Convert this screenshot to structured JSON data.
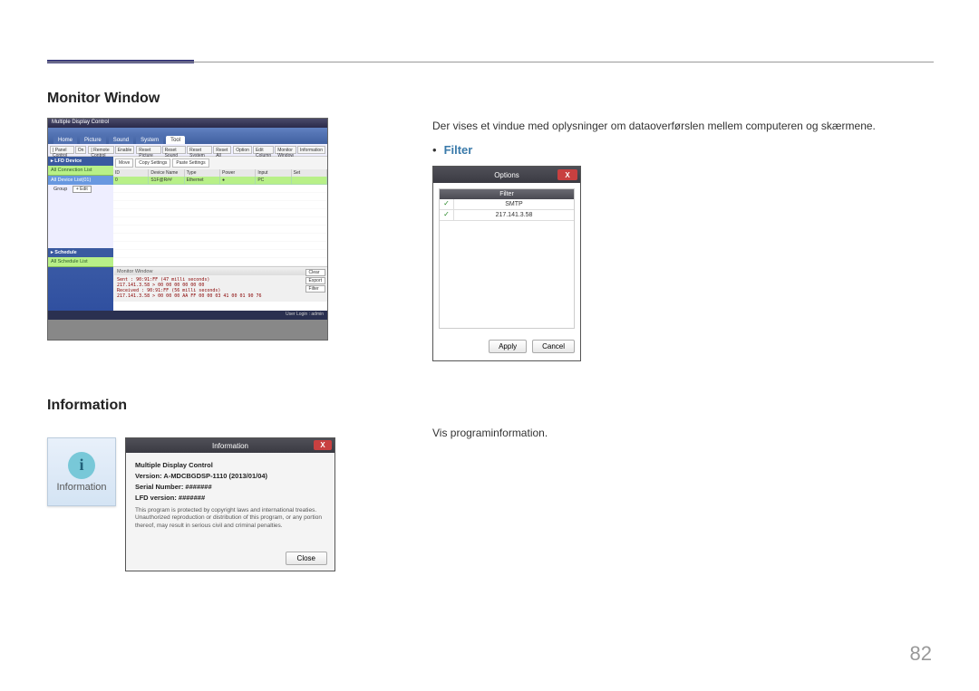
{
  "page_number": "82",
  "section1": {
    "heading": "Monitor Window",
    "desc": "Der vises et vindue med oplysninger om dataoverførslen mellem computeren og skærmene.",
    "bullet_label": "Filter"
  },
  "section2": {
    "heading": "Information",
    "desc": "Vis programinformation.",
    "icon_label": "Information"
  },
  "shot1": {
    "title": "Multiple Display Control",
    "tabs": [
      "Home",
      "Picture",
      "Sound",
      "System",
      "Tool"
    ],
    "panel_label": "| Panel Control",
    "panel_value": "On",
    "remote_label": "| Remote Control",
    "remote_value": "Enable",
    "toolbtns": [
      "Reset Picture",
      "Reset Sound",
      "Reset System",
      "Reset All",
      "Option",
      "Edit Column",
      "Monitor Window",
      "Information"
    ],
    "side_lfd": "▸ LFD Device",
    "side_all": "All Connection List",
    "side_device": "All Device List(01)",
    "side_group": "Group",
    "side_edit": "+ Edit",
    "side_sched": "▸ Schedule",
    "side_sched_all": "All Schedule List",
    "gridtools": [
      "Move",
      "Copy Settings",
      "Paste Settings"
    ],
    "cols": [
      "ID",
      "Device Name",
      "Type",
      "Power",
      "Input",
      "Set"
    ],
    "row": [
      "0",
      "S1F@R##",
      "Ethernet",
      "●",
      "PC",
      ""
    ],
    "mon_title": "Monitor Window",
    "log1": "Sent : 90:91:FF (47 milli seconds)",
    "log2": "217.141.3.58 > 00 00 00 00 00 00",
    "log3": "Received : 90:91:FF (56 milli seconds)",
    "log4": "217.141.3.58 > 00 00 00 AA FF 00 00 03 41 00 01 90 76",
    "btn_clear": "Clear",
    "btn_export": "Export",
    "btn_filter": "Filter",
    "footer": "User Login : admin"
  },
  "shot2": {
    "title": "Options",
    "col": "Filter",
    "rows": [
      "SMTP",
      "217.141.3.58"
    ],
    "apply": "Apply",
    "cancel": "Cancel"
  },
  "shot3": {
    "title": "Information",
    "l1": "Multiple Display Control",
    "l2": "Version: A-MDCBGDSP-1110 (2013/01/04)",
    "l3": "Serial Number: #######",
    "l4": "LFD version: #######",
    "prot": "This program is protected by copyright laws and international treaties. Unauthorized reproduction or distribution of this program, or any portion thereof, may result in serious civil and criminal penalties.",
    "close": "Close"
  }
}
